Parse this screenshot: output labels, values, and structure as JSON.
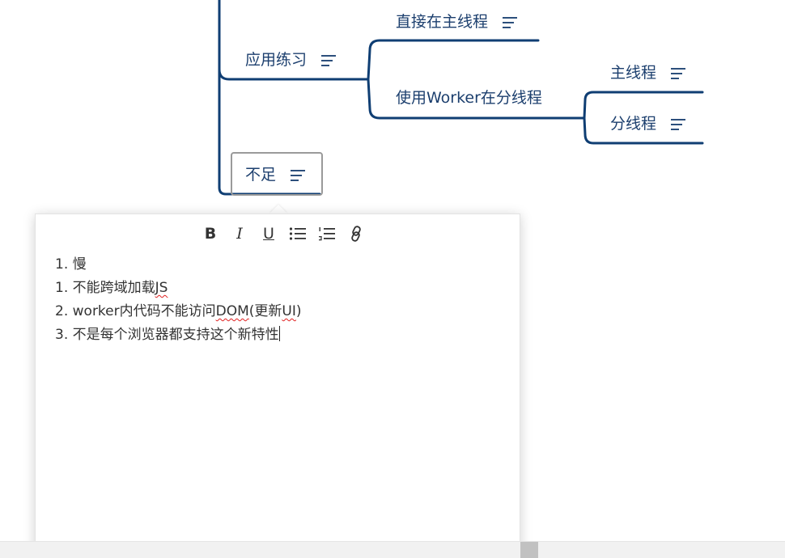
{
  "mindmap": {
    "nodes": {
      "practice": "应用练习",
      "direct": "直接在主线程",
      "worker": "使用Worker在分线程",
      "main_thread": "主线程",
      "sub_thread": "分线程",
      "shortcoming": "不足"
    },
    "line_color": "#0f3e73"
  },
  "note_editor": {
    "toolbar": {
      "bold": "B",
      "italic": "I",
      "underline": "U",
      "bullet_list": "bullet-list-icon",
      "ordered_list": "ordered-list-icon",
      "link": "link-icon"
    },
    "lines": [
      {
        "num": "1.",
        "text": "慢"
      },
      {
        "num": "1.",
        "pre": "不能跨域加载",
        "flag": "JS",
        "post": ""
      },
      {
        "num": "2.",
        "pre": "worker内代码不能访问",
        "flag": "DOM",
        "mid": "(更新",
        "flag2": "UI",
        "post": ")"
      },
      {
        "num": "3.",
        "text": "不是每个浏览器都支持这个新特性"
      }
    ]
  }
}
